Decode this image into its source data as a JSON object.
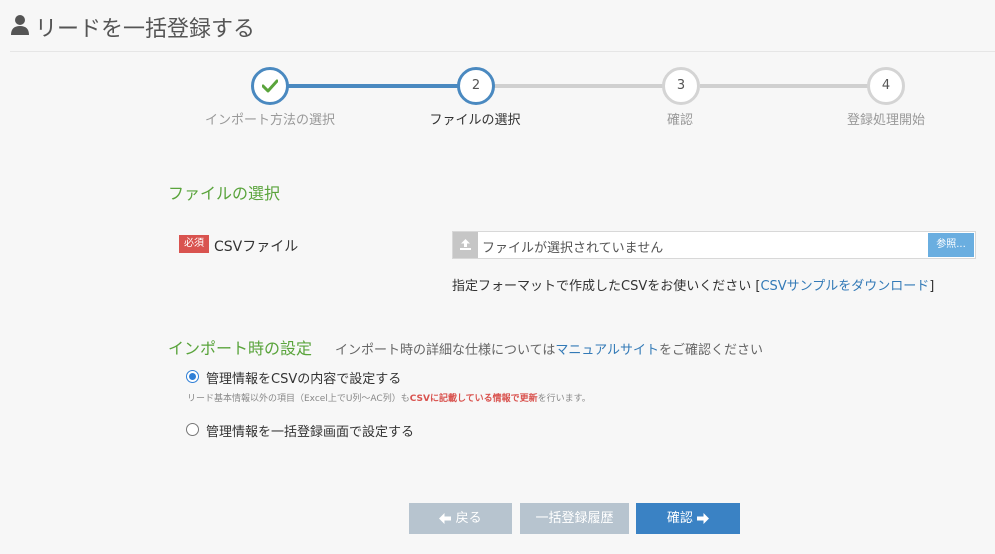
{
  "header": {
    "title": "リードを一括登録する",
    "icon": "user-icon"
  },
  "stepper": {
    "steps": [
      {
        "number": "1",
        "label": "インポート方法の選択",
        "state": "done"
      },
      {
        "number": "2",
        "label": "ファイルの選択",
        "state": "active"
      },
      {
        "number": "3",
        "label": "確認",
        "state": "pending"
      },
      {
        "number": "4",
        "label": "登録処理開始",
        "state": "pending"
      }
    ],
    "colors": {
      "done": "#4a89c0",
      "pending": "#d0d0d0",
      "check": "#5aa43c"
    }
  },
  "file_section": {
    "title": "ファイルの選択",
    "required_badge": "必須",
    "field_label": "CSVファイル",
    "placeholder": "ファイルが選択されていません",
    "browse_label": "参照...",
    "hint_text": "指定フォーマットで作成したCSVをお使いください",
    "sample_link_open": "[",
    "sample_link": "CSVサンプルをダウンロード",
    "sample_link_close": "]"
  },
  "import_settings": {
    "title": "インポート時の設定",
    "note_before": "インポート時の詳細な仕様については",
    "note_link": "マニュアルサイト",
    "note_after": "をご確認ください",
    "options": [
      {
        "label": "管理情報をCSVの内容で設定する",
        "checked": true
      },
      {
        "label": "管理情報を一括登録画面で設定する",
        "checked": false
      }
    ],
    "option_note_before": "リード基本情報以外の項目（Excel上でU列〜AC列）も",
    "option_note_emph": "CSVに記載している情報で更新",
    "option_note_after": "を行います。"
  },
  "buttons": {
    "back": "戻る",
    "history": "一括登録履歴",
    "confirm": "確認"
  },
  "colors": {
    "accent_green": "#5aa43c",
    "primary_blue": "#3a82c4",
    "disabled_gray": "#b7c4cf",
    "required_red": "#d9534f"
  }
}
